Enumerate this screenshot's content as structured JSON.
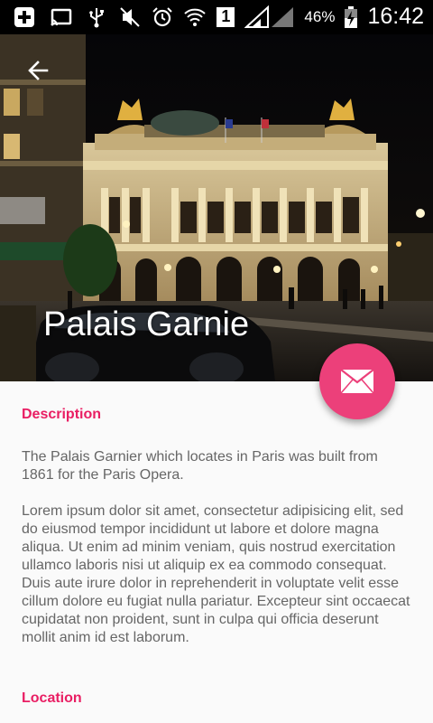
{
  "status_bar": {
    "battery": "46%",
    "time": "16:42",
    "sim_slot": "1",
    "icons": [
      "add-icon",
      "cast-icon",
      "usb-icon",
      "mute-icon",
      "alarm-icon",
      "wifi-icon",
      "sim-icon",
      "signal-icon",
      "battery-icon"
    ]
  },
  "hero": {
    "title": "Palais Garnie",
    "back_icon": "arrow-back-icon"
  },
  "fab": {
    "icon": "mail-icon",
    "color": "#ec407a"
  },
  "sections": {
    "description_heading": "Description",
    "paragraph1": "The Palais Garnier which locates in Paris was built from 1861 for the Paris Opera.",
    "paragraph2": "Lorem ipsum dolor sit amet, consectetur adipisicing elit, sed do eiusmod tempor incididunt ut labore et dolore magna aliqua. Ut enim ad minim veniam, quis nostrud exercitation ullamco laboris nisi ut aliquip ex ea commodo consequat. Duis aute irure dolor in reprehenderit in voluptate velit esse cillum dolore eu fugiat nulla pariatur. Excepteur sint occaecat cupidatat non proident, sunt in culpa qui officia deserunt mollit anim id est laborum.",
    "location_heading": "Location"
  },
  "colors": {
    "accent": "#e91e63",
    "status_bar": "#000000",
    "background": "#fafafa"
  }
}
